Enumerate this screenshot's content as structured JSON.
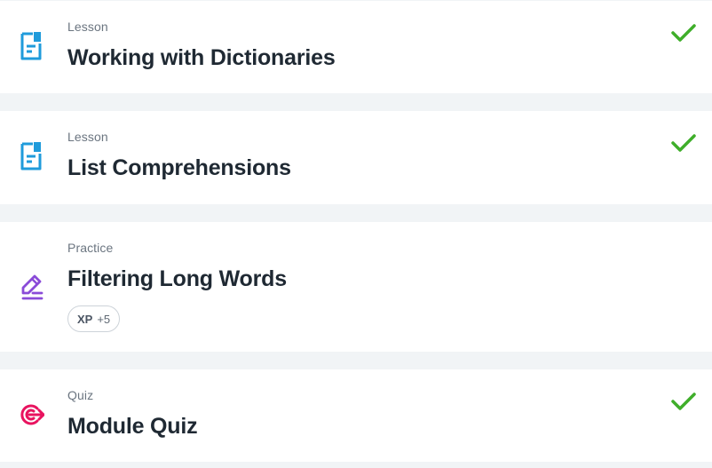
{
  "items": [
    {
      "kind": "Lesson",
      "title": "Working with Dictionaries",
      "icon": "lesson-document-icon",
      "completed": true
    },
    {
      "kind": "Lesson",
      "title": "List Comprehensions",
      "icon": "lesson-document-icon",
      "completed": true
    },
    {
      "kind": "Practice",
      "title": "Filtering Long Words",
      "icon": "practice-pencil-icon",
      "completed": false,
      "xp": {
        "label": "XP",
        "value": "+5"
      }
    },
    {
      "kind": "Quiz",
      "title": "Module Quiz",
      "icon": "quiz-target-icon",
      "completed": true
    }
  ],
  "colors": {
    "lesson_icon": "#1f9bdb",
    "practice_icon": "#8a4bd8",
    "quiz_icon": "#e8135f",
    "check": "#3fae2a",
    "page_background": "#f1f4f6"
  }
}
